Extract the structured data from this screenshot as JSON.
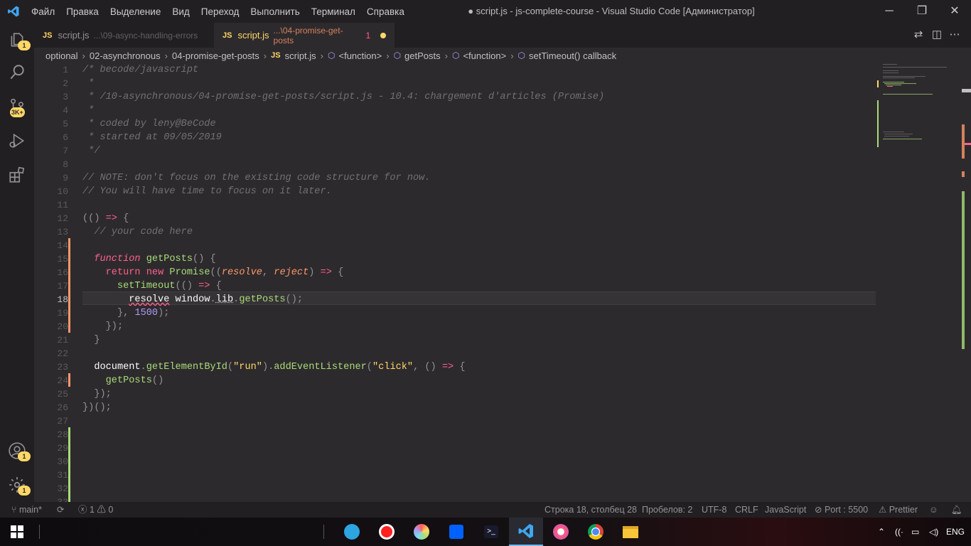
{
  "window": {
    "title": "● script.js - js-complete-course - Visual Studio Code [Администратор]",
    "menu": [
      "Файл",
      "Правка",
      "Выделение",
      "Вид",
      "Переход",
      "Выполнить",
      "Терминал",
      "Справка"
    ],
    "controls": {
      "minimize": "─",
      "restore": "❐",
      "close": "✕"
    }
  },
  "activity": {
    "explorer_badge": "1",
    "scm_badge": "3K+",
    "accounts_badge": "1",
    "settings_badge": "1"
  },
  "tabs": [
    {
      "icon": "JS",
      "name": "script.js",
      "path": "...\\09-async-handling-errors",
      "active": false
    },
    {
      "icon": "JS",
      "name": "script.js",
      "path": "...\\04-promise-get-posts",
      "problems": "1",
      "dirty": true,
      "active": true
    }
  ],
  "breadcrumbs": {
    "folders": [
      "optional",
      "02-asynchronous",
      "04-promise-get-posts"
    ],
    "file_icon": "JS",
    "file": "script.js",
    "symbols": [
      "<function>",
      "getPosts",
      "<function>",
      "setTimeout() callback"
    ]
  },
  "editor": {
    "current_line": 18,
    "line_numbers": [
      "1",
      "2",
      "3",
      "4",
      "5",
      "6",
      "7",
      "8",
      "9",
      "10",
      "11",
      "12",
      "13",
      "14",
      "15",
      "16",
      "17",
      "18",
      "19",
      "20",
      "21",
      "22",
      "23",
      "24",
      "25",
      "26",
      "27",
      "28",
      "29",
      "30",
      "31",
      "32",
      "33"
    ],
    "lines": [
      [
        [
          "cm",
          "/* becode/javascript"
        ]
      ],
      [
        [
          "cm",
          " *"
        ]
      ],
      [
        [
          "cm",
          " * /10-asynchronous/04-promise-get-posts/script.js - 10.4: chargement d'articles (Promise)"
        ]
      ],
      [
        [
          "cm",
          " *"
        ]
      ],
      [
        [
          "cm",
          " * coded by leny@BeCode"
        ]
      ],
      [
        [
          "cm",
          " * started at 09/05/2019"
        ]
      ],
      [
        [
          "cm",
          " */"
        ]
      ],
      [],
      [
        [
          "cm",
          "// NOTE: don't focus on the existing code structure for now."
        ]
      ],
      [
        [
          "cm",
          "// You will have time to focus on it later."
        ]
      ],
      [],
      [
        [
          "pu",
          "(() "
        ],
        [
          "op",
          "=>"
        ],
        [
          "pu",
          " {"
        ]
      ],
      [
        [
          "cm",
          "  // your code here"
        ]
      ],
      [],
      [
        [
          "tx",
          "  "
        ],
        [
          "kw it",
          "function"
        ],
        [
          "tx",
          " "
        ],
        [
          "fn",
          "getPosts"
        ],
        [
          "pu",
          "() {"
        ]
      ],
      [
        [
          "tx",
          "    "
        ],
        [
          "kw",
          "return"
        ],
        [
          "tx",
          " "
        ],
        [
          "kw",
          "new"
        ],
        [
          "tx",
          " "
        ],
        [
          "fn",
          "Promise"
        ],
        [
          "pu",
          "(("
        ],
        [
          "pa",
          "resolve"
        ],
        [
          "pu",
          ", "
        ],
        [
          "pa",
          "reject"
        ],
        [
          "pu",
          ") "
        ],
        [
          "op",
          "=>"
        ],
        [
          "pu",
          " {"
        ]
      ],
      [
        [
          "tx",
          "      "
        ],
        [
          "fn",
          "setTimeout"
        ],
        [
          "pu",
          "(() "
        ],
        [
          "op",
          "=>"
        ],
        [
          "pu",
          " {"
        ]
      ],
      [
        [
          "tx",
          "        "
        ],
        [
          "tx squig",
          "resolve"
        ],
        [
          "tx",
          " window"
        ],
        [
          "pu",
          "."
        ],
        [
          "tx dotted",
          "lib"
        ],
        [
          "pu",
          "."
        ],
        [
          "fn",
          "getPosts"
        ],
        [
          "pu",
          "();"
        ]
      ],
      [
        [
          "tx",
          "      "
        ],
        [
          "pu",
          "}, "
        ],
        [
          "nm",
          "1500"
        ],
        [
          "pu",
          ");"
        ]
      ],
      [
        [
          "tx",
          "    "
        ],
        [
          "pu",
          "});"
        ]
      ],
      [
        [
          "tx",
          "  "
        ],
        [
          "pu",
          "}"
        ]
      ],
      [],
      [
        [
          "tx",
          "  document"
        ],
        [
          "pu",
          "."
        ],
        [
          "fn",
          "getElementById"
        ],
        [
          "pu",
          "("
        ],
        [
          "st",
          "\"run\""
        ],
        [
          "pu",
          ")."
        ],
        [
          "fn",
          "addEventListener"
        ],
        [
          "pu",
          "("
        ],
        [
          "st",
          "\"click\""
        ],
        [
          "pu",
          ", () "
        ],
        [
          "op",
          "=>"
        ],
        [
          "pu",
          " {"
        ]
      ],
      [
        [
          "tx",
          "    "
        ],
        [
          "fn",
          "getPosts"
        ],
        [
          "pu",
          "()"
        ]
      ],
      [
        [
          "tx",
          "  "
        ],
        [
          "pu",
          "});"
        ]
      ],
      [
        [
          "pu",
          "})();"
        ]
      ],
      [],
      [],
      [],
      [],
      [],
      [],
      []
    ]
  },
  "status": {
    "branch": "main*",
    "errors": "1",
    "warnings": "0",
    "position": "Строка 18, столбец 28",
    "spaces": "Пробелов: 2",
    "encoding": "UTF-8",
    "eol": "CRLF",
    "language": "JavaScript",
    "port": "Port : 5500",
    "prettier": "Prettier"
  },
  "taskbar": {
    "language": "ENG",
    "apps": [
      "telegram-app",
      "recorder-app",
      "color-app",
      "dropbox-app",
      "terminal-app",
      "vscode-app",
      "itunes-app",
      "chrome-app",
      "explorer-app"
    ]
  }
}
